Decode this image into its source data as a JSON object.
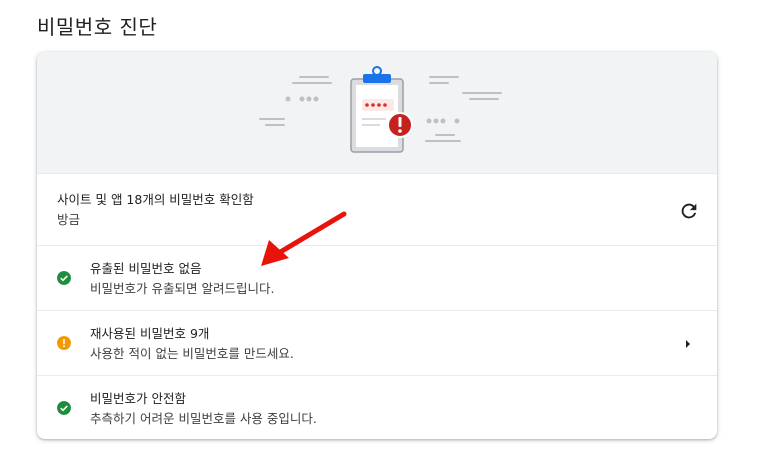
{
  "page": {
    "title": "비밀번호 진단"
  },
  "check": {
    "summary": "사이트 및 앱 18개의 비밀번호 확인함",
    "time": "방금"
  },
  "leaked": {
    "title": "유출된 비밀번호 없음",
    "description": "비밀번호가 유출되면 알려드립니다.",
    "status_color": "#1e8e3e"
  },
  "reused": {
    "title": "재사용된 비밀번호 9개",
    "description": "사용한 적이 없는 비밀번호를 만드세요.",
    "status_color": "#f29900"
  },
  "weak": {
    "title": "비밀번호가 안전함",
    "description": "추측하기 어려운 비밀번호를 사용 중입니다.",
    "status_color": "#1e8e3e"
  },
  "icons": {
    "refresh": "refresh-icon",
    "chevron": "chevron-right-icon",
    "check": "check-circle-icon",
    "warning": "warning-circle-icon",
    "illustration": "clipboard-alert-icon",
    "annotation": "red-arrow"
  },
  "colors": {
    "accent": "#1a73e8",
    "error": "#c5221f",
    "annotation": "#e8140c"
  }
}
